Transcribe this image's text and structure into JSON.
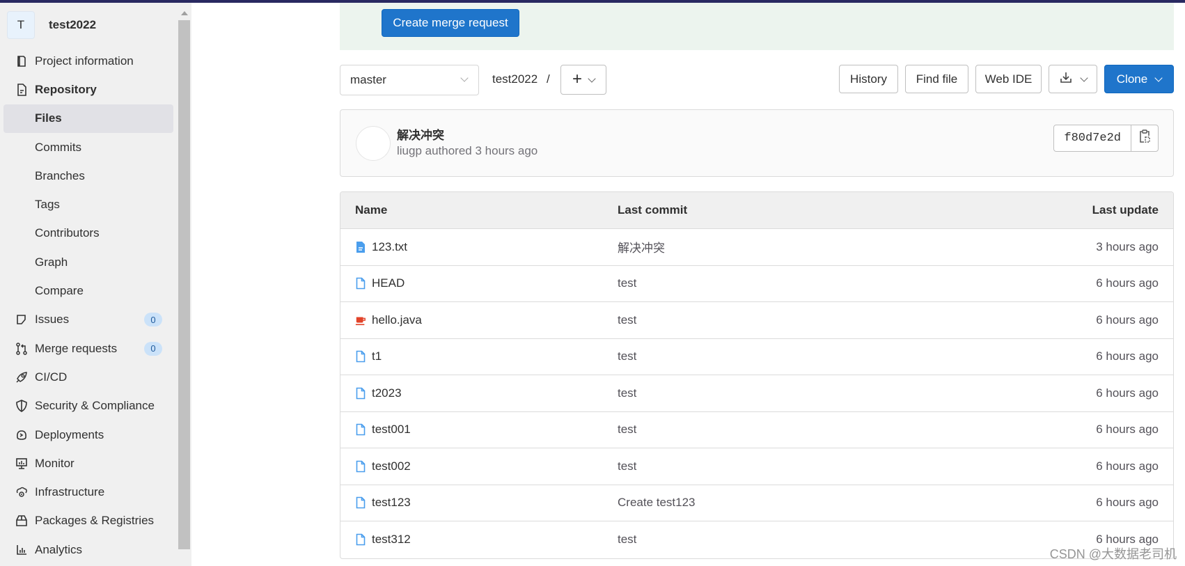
{
  "sidebar": {
    "project_initial": "T",
    "project_name": "test2022",
    "items": [
      {
        "label": "Project information",
        "icon": "project-icon"
      },
      {
        "label": "Repository",
        "icon": "document-icon"
      },
      {
        "label": "Files"
      },
      {
        "label": "Commits"
      },
      {
        "label": "Branches"
      },
      {
        "label": "Tags"
      },
      {
        "label": "Contributors"
      },
      {
        "label": "Graph"
      },
      {
        "label": "Compare"
      },
      {
        "label": "Issues",
        "icon": "issues-icon",
        "badge": "0"
      },
      {
        "label": "Merge requests",
        "icon": "merge-request-icon",
        "badge": "0"
      },
      {
        "label": "CI/CD",
        "icon": "rocket-icon"
      },
      {
        "label": "Security & Compliance",
        "icon": "shield-icon"
      },
      {
        "label": "Deployments",
        "icon": "deployments-icon"
      },
      {
        "label": "Monitor",
        "icon": "monitor-icon"
      },
      {
        "label": "Infrastructure",
        "icon": "cloud-gear-icon"
      },
      {
        "label": "Packages & Registries",
        "icon": "package-icon"
      },
      {
        "label": "Analytics",
        "icon": "chart-icon"
      }
    ]
  },
  "banner": {
    "create_mr_label": "Create merge request"
  },
  "toolbar": {
    "branch": "master",
    "breadcrumb_project": "test2022",
    "breadcrumb_sep": "/",
    "history_label": "History",
    "find_file_label": "Find file",
    "web_ide_label": "Web IDE",
    "clone_label": "Clone"
  },
  "commit": {
    "title": "解决冲突",
    "meta": "liugp authored 3 hours ago",
    "sha": "f80d7e2d"
  },
  "table": {
    "headers": {
      "name": "Name",
      "last_commit": "Last commit",
      "last_update": "Last update"
    },
    "rows": [
      {
        "name": "123.txt",
        "commit": "解决冲突",
        "updated": "3 hours ago",
        "type": "text"
      },
      {
        "name": "HEAD",
        "commit": "test",
        "updated": "6 hours ago",
        "type": "file"
      },
      {
        "name": "hello.java",
        "commit": "test",
        "updated": "6 hours ago",
        "type": "java"
      },
      {
        "name": "t1",
        "commit": "test",
        "updated": "6 hours ago",
        "type": "file"
      },
      {
        "name": "t2023",
        "commit": "test",
        "updated": "6 hours ago",
        "type": "file"
      },
      {
        "name": "test001",
        "commit": "test",
        "updated": "6 hours ago",
        "type": "file"
      },
      {
        "name": "test002",
        "commit": "test",
        "updated": "6 hours ago",
        "type": "file"
      },
      {
        "name": "test123",
        "commit": "Create test123",
        "updated": "6 hours ago",
        "type": "file"
      },
      {
        "name": "test312",
        "commit": "test",
        "updated": "6 hours ago",
        "type": "file"
      }
    ]
  },
  "colors": {
    "primary": "#1f75cb",
    "banner_bg": "#ecf4ee",
    "file_icon": "#4a9eed",
    "java_icon": "#e24329"
  },
  "watermark": "CSDN @大数据老司机"
}
